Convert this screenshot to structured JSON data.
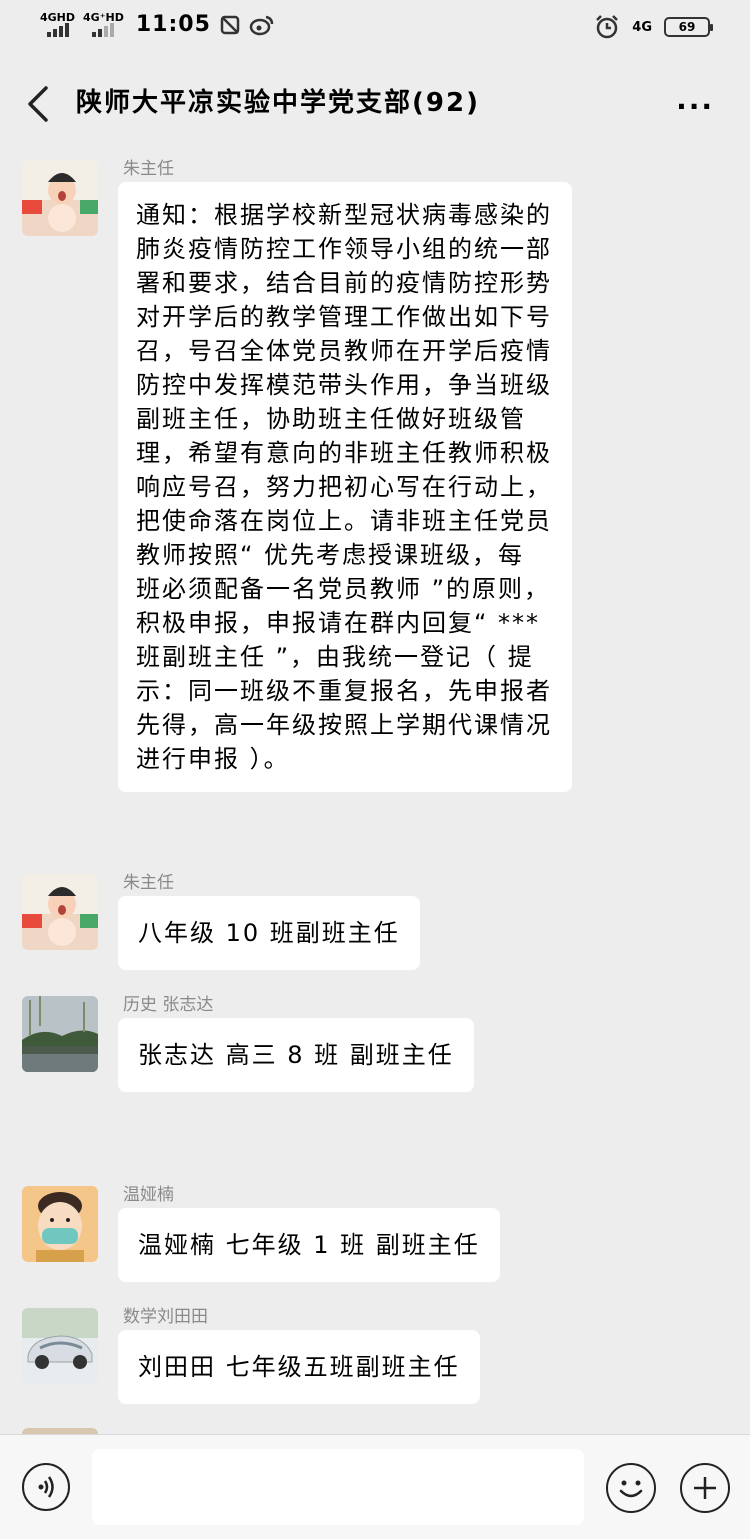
{
  "status_bar": {
    "net1": "4GHD",
    "net2": "4G⁺HD",
    "time": "11:05",
    "net_right": "4G",
    "battery": "69"
  },
  "header": {
    "title": "陕师大平凉实验中学党支部(92)",
    "more": "···"
  },
  "messages": [
    {
      "sender": "朱主任",
      "avatar": "baby-photo",
      "lines": [
        "通知：根据学校新型冠状病毒感染的",
        "肺炎疫情防控工作领导小组的统一部",
        "署和要求，结合目前的疫情防控形势",
        "对开学后的教学管理工作做出如下号",
        "召，号召全体党员教师在开学后疫情",
        "防控中发挥模范带头作用，争当班级",
        "副班主任，协助班主任做好班级管",
        "理，希望有意向的非班主任教师积极",
        "响应号召，努力把初心写在行动上，",
        "把使命落在岗位上。请非班主任党员",
        "教师按照“ 优先考虑授课班级，每",
        "班必须配备一名党员教师 ”的原则，",
        "积极申报，申报请在群内回复“ ***",
        "班副班主任 ”，由我统一登记（ 提",
        "示：同一班级不重复报名，先申报者",
        "先得，高一年级按照上学期代课情况",
        "进行申报 ）。"
      ]
    },
    {
      "sender": "朱主任",
      "avatar": "baby-photo",
      "text": "八年级 10 班副班主任"
    },
    {
      "sender": "历史 张志达",
      "avatar": "landscape-photo",
      "text": "张志达 高三 8 班 副班主任"
    },
    {
      "sender": "温娅楠",
      "avatar": "cartoon-mask-girl",
      "text": "温娅楠 七年级 1 班 副班主任"
    },
    {
      "sender": "数学刘田田",
      "avatar": "car-photo",
      "text": "刘田田 七年级五班副班主任"
    }
  ],
  "input_bar": {
    "voice_icon": "voice-icon",
    "emoji_icon": "emoji-icon",
    "plus_icon": "plus-icon"
  }
}
